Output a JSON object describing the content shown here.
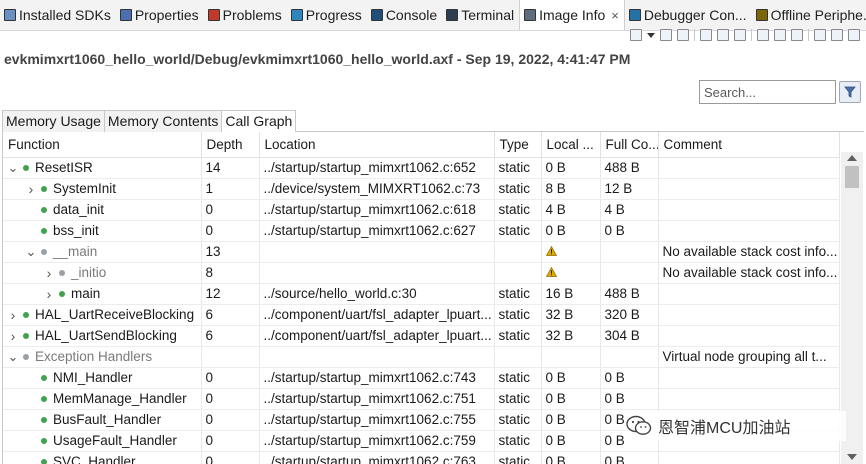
{
  "view_tabs": [
    {
      "label": "Installed SDKs",
      "icon": "sdk-icon",
      "active": false
    },
    {
      "label": "Properties",
      "icon": "properties-icon",
      "active": false
    },
    {
      "label": "Problems",
      "icon": "problems-icon",
      "active": false
    },
    {
      "label": "Progress",
      "icon": "progress-icon",
      "active": false
    },
    {
      "label": "Console",
      "icon": "console-icon",
      "active": false
    },
    {
      "label": "Terminal",
      "icon": "terminal-icon",
      "active": false
    },
    {
      "label": "Image Info",
      "icon": "image-info-icon",
      "active": true,
      "close": "×"
    },
    {
      "label": "Debugger Con...",
      "icon": "debugger-console-icon",
      "active": false
    },
    {
      "label": "Offline Periphe...",
      "icon": "offline-peripherals-icon",
      "active": false
    }
  ],
  "file_path": "evkmimxrt1060_hello_world/Debug/evkmimxrt1060_hello_world.axf - Sep 19, 2022, 4:41:47 PM",
  "search": {
    "placeholder": "Search..."
  },
  "inner_tabs": [
    "Memory Usage",
    "Memory Contents",
    "Call Graph"
  ],
  "active_inner_tab": "Call Graph",
  "columns": [
    "Function",
    "Depth",
    "Location",
    "Type",
    "Local ...",
    "Full Co...",
    "Comment"
  ],
  "rows": [
    {
      "level": 0,
      "twisty": "open",
      "dot": "green",
      "virtual": false,
      "function": "ResetISR",
      "depth": "14",
      "location": "../startup/startup_mimxrt1062.c:652",
      "type": "static",
      "local": "0 B",
      "full": "488 B",
      "comment": ""
    },
    {
      "level": 1,
      "twisty": "closed",
      "dot": "green",
      "virtual": false,
      "function": "SystemInit",
      "depth": "1",
      "location": "../device/system_MIMXRT1062.c:73",
      "type": "static",
      "local": "8 B",
      "full": "12 B",
      "comment": ""
    },
    {
      "level": 1,
      "twisty": "none",
      "dot": "green",
      "virtual": false,
      "function": "data_init",
      "depth": "0",
      "location": "../startup/startup_mimxrt1062.c:618",
      "type": "static",
      "local": "4 B",
      "full": "4 B",
      "comment": ""
    },
    {
      "level": 1,
      "twisty": "none",
      "dot": "green",
      "virtual": false,
      "function": "bss_init",
      "depth": "0",
      "location": "../startup/startup_mimxrt1062.c:627",
      "type": "static",
      "local": "0 B",
      "full": "0 B",
      "comment": ""
    },
    {
      "level": 1,
      "twisty": "open",
      "dot": "grey",
      "virtual": true,
      "function": "__main",
      "depth": "13",
      "location": "",
      "type": "",
      "local": "warn",
      "full": "",
      "comment": "No available stack cost info..."
    },
    {
      "level": 2,
      "twisty": "closed",
      "dot": "grey",
      "virtual": true,
      "function": "_initio",
      "depth": "8",
      "location": "",
      "type": "",
      "local": "warn",
      "full": "",
      "comment": "No available stack cost info..."
    },
    {
      "level": 2,
      "twisty": "closed",
      "dot": "green",
      "virtual": false,
      "function": "main",
      "depth": "12",
      "location": "../source/hello_world.c:30",
      "type": "static",
      "local": "16 B",
      "full": "488 B",
      "comment": ""
    },
    {
      "level": 0,
      "twisty": "closed",
      "dot": "green",
      "virtual": false,
      "function": "HAL_UartReceiveBlocking",
      "depth": "6",
      "location": "../component/uart/fsl_adapter_lpuart...",
      "type": "static",
      "local": "32 B",
      "full": "320 B",
      "comment": ""
    },
    {
      "level": 0,
      "twisty": "closed",
      "dot": "green",
      "virtual": false,
      "function": "HAL_UartSendBlocking",
      "depth": "6",
      "location": "../component/uart/fsl_adapter_lpuart...",
      "type": "static",
      "local": "32 B",
      "full": "304 B",
      "comment": ""
    },
    {
      "level": 0,
      "twisty": "open",
      "dot": "grey",
      "virtual": true,
      "function": "Exception Handlers",
      "depth": "",
      "location": "",
      "type": "",
      "local": "",
      "full": "",
      "comment": "Virtual node grouping all t..."
    },
    {
      "level": 1,
      "twisty": "none",
      "dot": "green",
      "virtual": false,
      "function": "NMI_Handler",
      "depth": "0",
      "location": "../startup/startup_mimxrt1062.c:743",
      "type": "static",
      "local": "0 B",
      "full": "0 B",
      "comment": ""
    },
    {
      "level": 1,
      "twisty": "none",
      "dot": "green",
      "virtual": false,
      "function": "MemManage_Handler",
      "depth": "0",
      "location": "../startup/startup_mimxrt1062.c:751",
      "type": "static",
      "local": "0 B",
      "full": "0 B",
      "comment": ""
    },
    {
      "level": 1,
      "twisty": "none",
      "dot": "green",
      "virtual": false,
      "function": "BusFault_Handler",
      "depth": "0",
      "location": "../startup/startup_mimxrt1062.c:755",
      "type": "static",
      "local": "0 B",
      "full": "0 B",
      "comment": ""
    },
    {
      "level": 1,
      "twisty": "none",
      "dot": "green",
      "virtual": false,
      "function": "UsageFault_Handler",
      "depth": "0",
      "location": "../startup/startup_mimxrt1062.c:759",
      "type": "static",
      "local": "0 B",
      "full": "0 B",
      "comment": ""
    },
    {
      "level": 1,
      "twisty": "none",
      "dot": "green",
      "virtual": false,
      "function": "SVC_Handler",
      "depth": "0",
      "location": "../startup/startup_mimxrt1062.c:763",
      "type": "static",
      "local": "0 B",
      "full": "0 B",
      "comment": ""
    }
  ],
  "watermark": {
    "text": "恩智浦MCU加油站",
    "icon": "wechat-logo-icon"
  },
  "colors": {
    "green_dot": "#3fa34d",
    "grey_dot": "#9aa0a6",
    "warning": "#e0a800"
  }
}
